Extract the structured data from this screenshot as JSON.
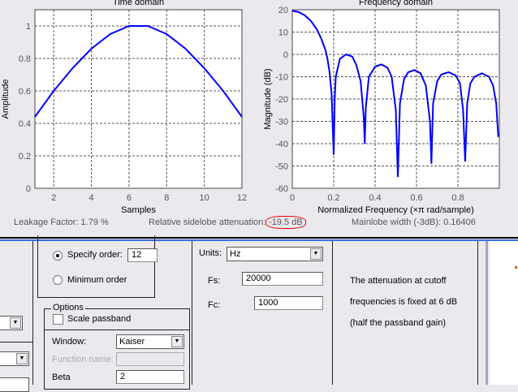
{
  "chart_data": [
    {
      "type": "line",
      "title": "Time domain",
      "xlabel": "Samples",
      "ylabel": "Amplitude",
      "xlim": [
        1,
        12
      ],
      "ylim": [
        0,
        1.1
      ],
      "xticks": [
        2,
        4,
        6,
        8,
        10,
        12
      ],
      "yticks": [
        0,
        0.2,
        0.4,
        0.6,
        0.8,
        1
      ],
      "grid": true,
      "x": [
        1,
        2,
        3,
        4,
        5,
        6,
        7,
        8,
        9,
        10,
        11,
        12
      ],
      "y": [
        0.44,
        0.6,
        0.74,
        0.86,
        0.95,
        1.0,
        1.0,
        0.95,
        0.86,
        0.74,
        0.6,
        0.44
      ],
      "series_color": "#0000ff"
    },
    {
      "type": "line",
      "title": "Frequency domain",
      "xlabel": "Normalized Frequency  (×π rad/sample)",
      "ylabel": "Magnitude (dB)",
      "xlim": [
        0,
        1
      ],
      "ylim": [
        -60,
        20
      ],
      "xticks": [
        0,
        0.2,
        0.4,
        0.6,
        0.8
      ],
      "yticks": [
        20,
        10,
        0,
        -10,
        -20,
        -30,
        -40,
        -50,
        -60
      ],
      "grid": true,
      "x": [
        0,
        0.03,
        0.06,
        0.09,
        0.12,
        0.14,
        0.16,
        0.17,
        0.18,
        0.19,
        0.2,
        0.205,
        0.21,
        0.23,
        0.26,
        0.29,
        0.31,
        0.33,
        0.345,
        0.35,
        0.355,
        0.37,
        0.4,
        0.43,
        0.46,
        0.48,
        0.5,
        0.51,
        0.52,
        0.54,
        0.56,
        0.59,
        0.62,
        0.645,
        0.665,
        0.672,
        0.68,
        0.7,
        0.72,
        0.755,
        0.79,
        0.81,
        0.825,
        0.835,
        0.845,
        0.86,
        0.88,
        0.915,
        0.95,
        0.97,
        0.985,
        0.995
      ],
      "y": [
        19.5,
        19,
        17.5,
        15,
        11,
        7,
        2,
        -2,
        -8,
        -18,
        -45,
        -20,
        -10,
        -2,
        0,
        -1,
        -5,
        -12,
        -28,
        -40,
        -24,
        -10,
        -5.5,
        -4.5,
        -6,
        -10,
        -25,
        -55,
        -22,
        -11,
        -8,
        -7,
        -8.5,
        -14,
        -30,
        -49,
        -22,
        -12,
        -9,
        -8,
        -9.5,
        -13,
        -25,
        -48,
        -22,
        -13,
        -10,
        -8.5,
        -10,
        -14,
        -22,
        -37
      ],
      "series_color": "#0000ff"
    }
  ],
  "metrics": {
    "leakage": "Leakage Factor: 1.79 %",
    "sidelobe": "Relative sidelobe attenuation:",
    "sidelobe_value": "-19.5 dB",
    "mainlobe": "Mainlobe width (-3dB): 0.16406"
  },
  "order": {
    "specify_label": "Specify order:",
    "specify_value": "12",
    "minimum_label": "Minimum order"
  },
  "options": {
    "title": "Options",
    "scale_passband": "Scale passband",
    "window_label": "Window:",
    "window_value": "Kaiser",
    "function_label": "Function name:",
    "function_value": "",
    "beta_label": "Beta",
    "beta_value": "2"
  },
  "freq": {
    "units_label": "Units:",
    "units_value": "Hz",
    "fs_label": "Fs:",
    "fs_value": "20000",
    "fc_label": "Fc:",
    "fc_value": "1000"
  },
  "note": {
    "line1": "The attenuation at cutoff",
    "line2": "frequencies is fixed at 6 dB",
    "line3": "(half the passband gain)"
  }
}
